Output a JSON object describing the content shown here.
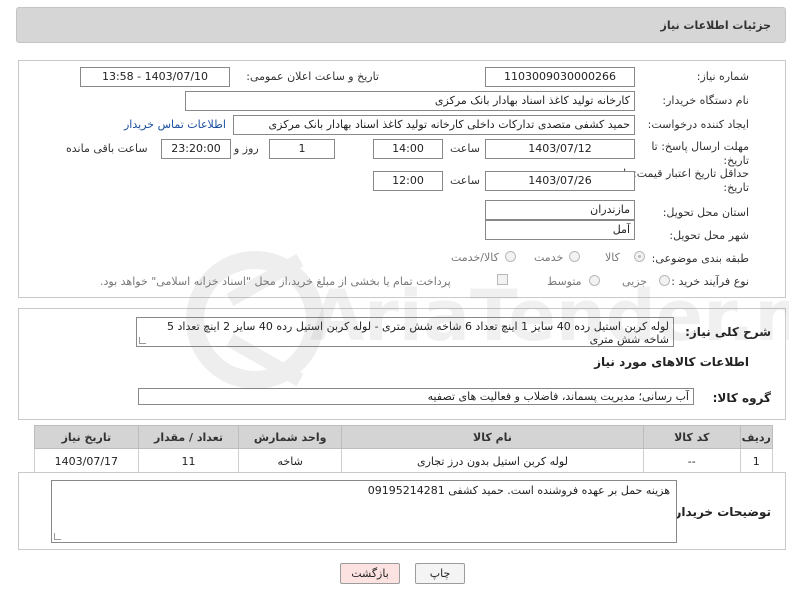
{
  "header": {
    "title": "جزئیات اطلاعات نیاز"
  },
  "form": {
    "need_number_label": "شماره نیاز:",
    "need_number": "1103009030000266",
    "announce_label": "تاریخ و ساعت اعلان عمومی:",
    "announce_value": "1403/07/10 - 13:58",
    "buyer_org_label": "نام دستگاه خریدار:",
    "buyer_org": "کارخانه تولید کاغذ اسناد بهادار بانک مرکزی",
    "creator_label": "ایجاد کننده درخواست:",
    "creator": "حمید کشفی متصدی تدارکات داخلی کارخانه تولید کاغذ اسناد بهادار بانک مرکزی",
    "contact_link": "اطلاعات تماس خریدار",
    "deadline_label": "مهلت ارسال پاسخ: تا تاریخ:",
    "deadline_date": "1403/07/12",
    "time_label": "ساعت",
    "deadline_time": "14:00",
    "days_value": "1",
    "days_label": "روز و",
    "remaining_time": "23:20:00",
    "remaining_label": "ساعت باقی مانده",
    "validity_label": "حداقل تاریخ اعتبار قیمت: تا تاریخ:",
    "validity_date": "1403/07/26",
    "validity_time": "12:00",
    "province_label": "استان محل تحویل:",
    "province": "مازندران",
    "city_label": "شهر محل تحویل:",
    "city": "آمل",
    "category_label": "طبقه بندی موضوعی:",
    "category_options": [
      "کالا",
      "خدمت",
      "کالا/خدمت"
    ],
    "purchase_type_label": "نوع فرآیند خرید :",
    "purchase_options": [
      "جزیی",
      "متوسط"
    ],
    "payment_note": "پرداخت تمام یا بخشی از مبلغ خرید،از محل \"اسناد خزانه اسلامی\" خواهد بود."
  },
  "summary": {
    "label": "شرح کلی نیاز:",
    "text": "لوله کربن استیل رده 40 سایز 1 اینچ تعداد 6 شاخه شش متری - لوله کربن استیل رده 40 سایز 2 اینچ تعداد 5 شاخه شش متری"
  },
  "goods": {
    "section_title": "اطلاعات کالاهای مورد نیاز",
    "group_label": "گروه کالا:",
    "group_value": "آب رسانی؛ مدیریت پسماند، فاضلاب و فعالیت های تصفیه",
    "columns": [
      "ردیف",
      "کد کالا",
      "نام کالا",
      "واحد شمارش",
      "تعداد / مقدار",
      "تاریخ نیاز"
    ],
    "rows": [
      [
        "1",
        "--",
        "لوله کربن استیل بدون درز تجاری",
        "شاخه",
        "11",
        "1403/07/17"
      ]
    ]
  },
  "notes": {
    "label": "توضیحات خریدار:",
    "text": "هزینه حمل بر عهده فروشنده است. حمید کشفی 09195214281"
  },
  "buttons": {
    "print": "چاپ",
    "back": "بازگشت"
  },
  "colors": {
    "title_bg": "#d6d6d6",
    "back_button_bg": "#fde2e2",
    "link": "#1a4ea0"
  }
}
